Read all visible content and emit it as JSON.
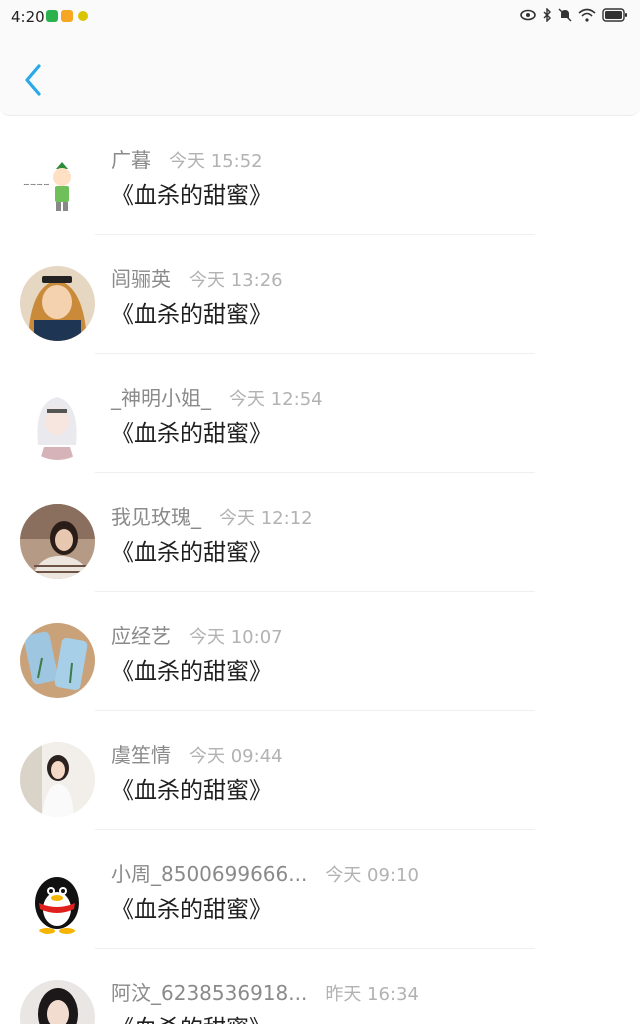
{
  "status_bar": {
    "time": "4:20",
    "left_icons": [
      "wechat-icon",
      "weibo-icon",
      "notification-dot-icon"
    ],
    "right_icons": [
      "eye-icon",
      "bluetooth-icon",
      "mute-bell-icon",
      "wifi-icon",
      "battery-icon"
    ]
  },
  "header": {
    "back_icon": "chevron-left-icon",
    "accent_color": "#2aa8e8"
  },
  "rows": [
    {
      "name": "广暮",
      "time": "今天 15:52",
      "title": "《血杀的甜蜜》",
      "avatar": "cartoon-figure-avatar"
    },
    {
      "name": "闾骊英",
      "time": "今天 13:26",
      "title": "《血杀的甜蜜》",
      "avatar": "anime-girl-avatar"
    },
    {
      "name": "_神明小姐_",
      "time": "今天 12:54",
      "title": "《血杀的甜蜜》",
      "avatar": "anime-white-hair-avatar"
    },
    {
      "name": "我见玫瑰_",
      "time": "今天 12:12",
      "title": "《血杀的甜蜜》",
      "avatar": "photo-girl-avatar"
    },
    {
      "name": "应经艺",
      "time": "今天 10:07",
      "title": "《血杀的甜蜜》",
      "avatar": "phone-cases-avatar"
    },
    {
      "name": "虞笙情",
      "time": "今天 09:44",
      "title": "《血杀的甜蜜》",
      "avatar": "photo-girl-avatar"
    },
    {
      "name": "小周_8500699666...",
      "time": "今天 09:10",
      "title": "《血杀的甜蜜》",
      "avatar": "qq-penguin-avatar"
    },
    {
      "name": "阿汶_6238536918...",
      "time": "昨天 16:34",
      "title": "《血杀的甜蜜》",
      "avatar": "photo-girl-avatar"
    }
  ]
}
